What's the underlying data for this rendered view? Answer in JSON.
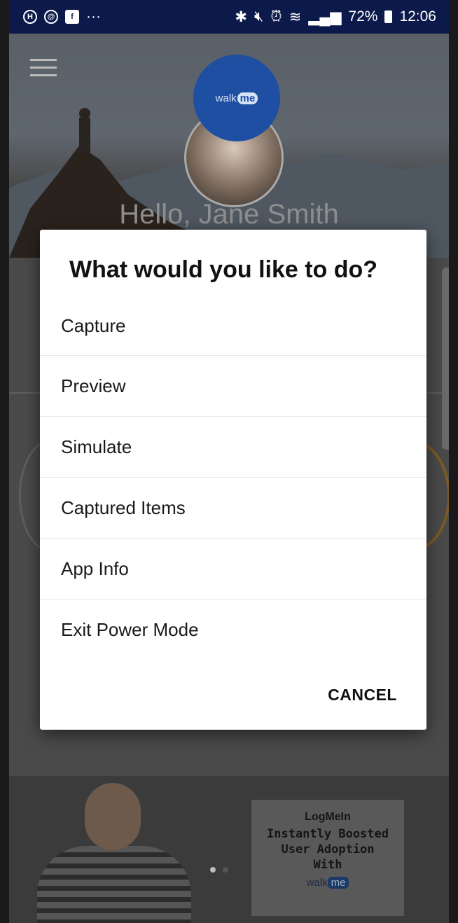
{
  "status_bar": {
    "battery": "72%",
    "time": "12:06",
    "overflow": "···",
    "icons_left": [
      "notification-icon",
      "account-icon",
      "facebook-icon"
    ],
    "icons_right": [
      "bluetooth-icon",
      "mute-icon",
      "alarm-icon",
      "wifi-icon",
      "signal-icon",
      "battery-icon"
    ]
  },
  "app": {
    "greeting": "Hello, Jane Smith",
    "walkme_logo": {
      "walk": "walk",
      "me": "me"
    }
  },
  "dialog": {
    "title": "What would you like to do?",
    "options": [
      {
        "label": "Capture"
      },
      {
        "label": "Preview"
      },
      {
        "label": "Simulate"
      },
      {
        "label": "Captured Items"
      },
      {
        "label": "App Info"
      },
      {
        "label": "Exit Power Mode"
      }
    ],
    "cancel_label": "CANCEL"
  },
  "banner": {
    "brand": "LogMe",
    "brand_in": "In",
    "line1": "Instantly Boosted",
    "line2": "User Adoption",
    "line3": "With",
    "walk": "walk",
    "me": "me"
  }
}
